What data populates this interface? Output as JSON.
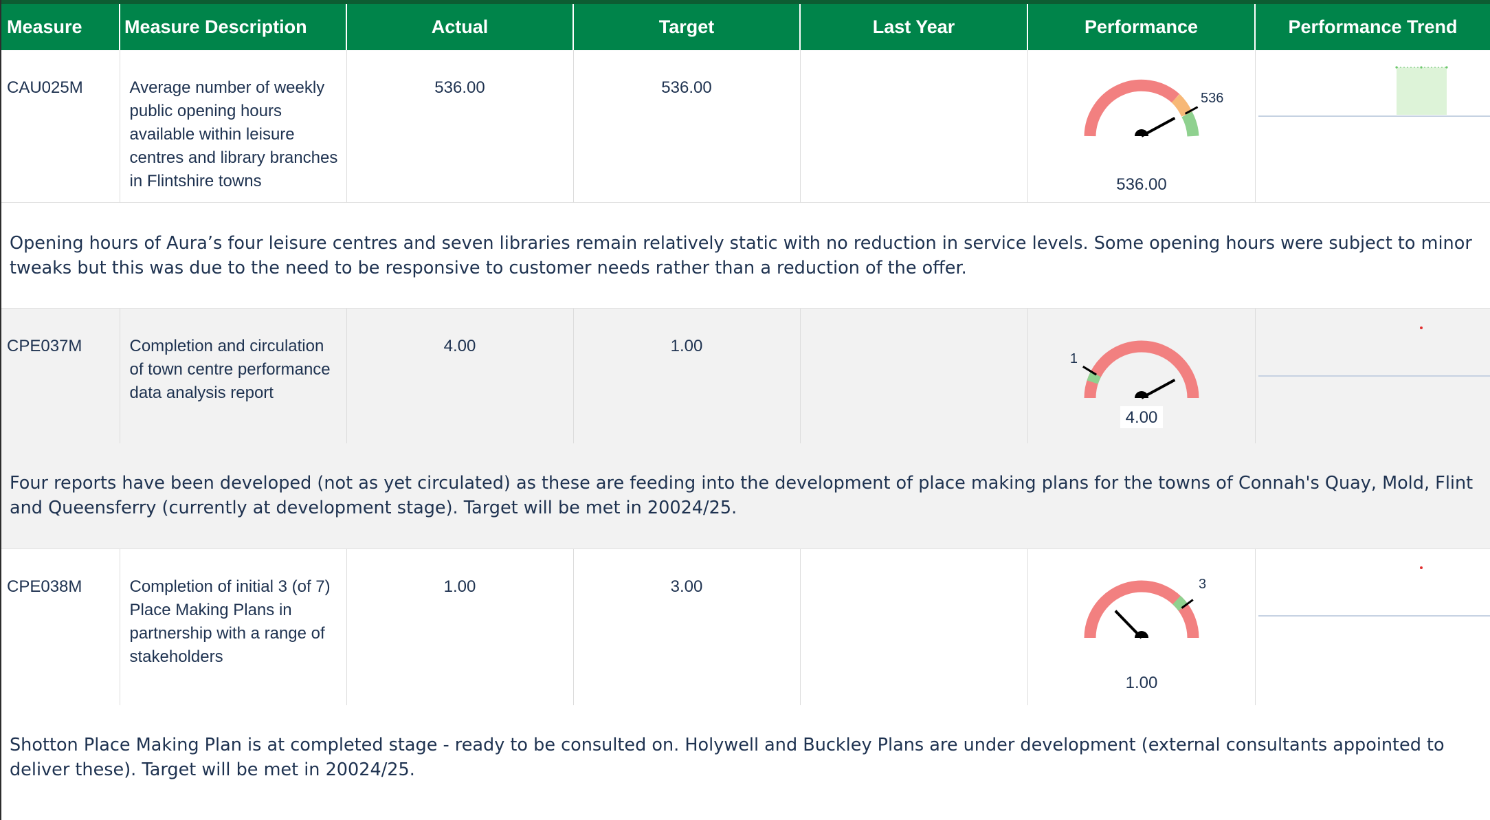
{
  "headers": {
    "measure": "Measure",
    "description": "Measure Description",
    "actual": "Actual",
    "target": "Target",
    "last_year": "Last Year",
    "performance": "Performance",
    "trend": "Performance Trend"
  },
  "colors": {
    "header_bg": "#00844a",
    "gauge_red": "#f28080",
    "gauge_amber": "#f7b877",
    "gauge_green": "#8fd18f",
    "needle": "#000000",
    "trend_fill": "#ddf3d8",
    "trend_point_green": "#6cc76c",
    "trend_point_red": "#e03030",
    "alt_row": "#f2f2f2"
  },
  "rows": [
    {
      "measure": "CAU025M",
      "description": "Average number of weekly public opening hours available within leisure centres and library branches in Flintshire towns",
      "actual": "536.00",
      "target": "536.00",
      "last_year": "",
      "gauge": {
        "target_label": "536",
        "value_label": "536.00",
        "needle_fraction": 0.82,
        "target_fraction": 0.82,
        "bands": [
          "red",
          "amber",
          "green"
        ]
      },
      "trend": {
        "status": "green"
      },
      "comment": "Opening hours of Aura’s four leisure centres and seven libraries remain relatively static with no reduction in service levels. Some opening hours were subject to minor tweaks but this was due to the need to be responsive to customer needs rather than a reduction of the offer."
    },
    {
      "measure": "CPE037M",
      "description": "Completion and circulation of town centre performance data analysis report",
      "actual": "4.00",
      "target": "1.00",
      "last_year": "",
      "gauge": {
        "target_label": "1",
        "value_label": "4.00",
        "needle_fraction": 0.82,
        "target_fraction": 0.18,
        "bands": [
          "red",
          "green-marker"
        ]
      },
      "trend": {
        "status": "red"
      },
      "comment": "Four reports have been developed (not as yet circulated) as these are feeding into the development of place making plans for the towns of Connah's Quay, Mold, Flint and Queensferry (currently at development stage).  Target will be met in 20024/25."
    },
    {
      "measure": "CPE038M",
      "description": "Completion of initial 3 (of 7) Place Making Plans in partnership with a range of stakeholders",
      "actual": "1.00",
      "target": "3.00",
      "last_year": "",
      "gauge": {
        "target_label": "3",
        "value_label": "1.00",
        "needle_fraction": 0.27,
        "target_fraction": 0.77,
        "bands": [
          "red",
          "green-marker"
        ]
      },
      "trend": {
        "status": "red"
      },
      "comment": "Shotton Place Making Plan is at completed stage - ready to be consulted on. Holywell and Buckley Plans are under development (external consultants appointed to deliver these).  Target will be met in 20024/25."
    }
  ]
}
